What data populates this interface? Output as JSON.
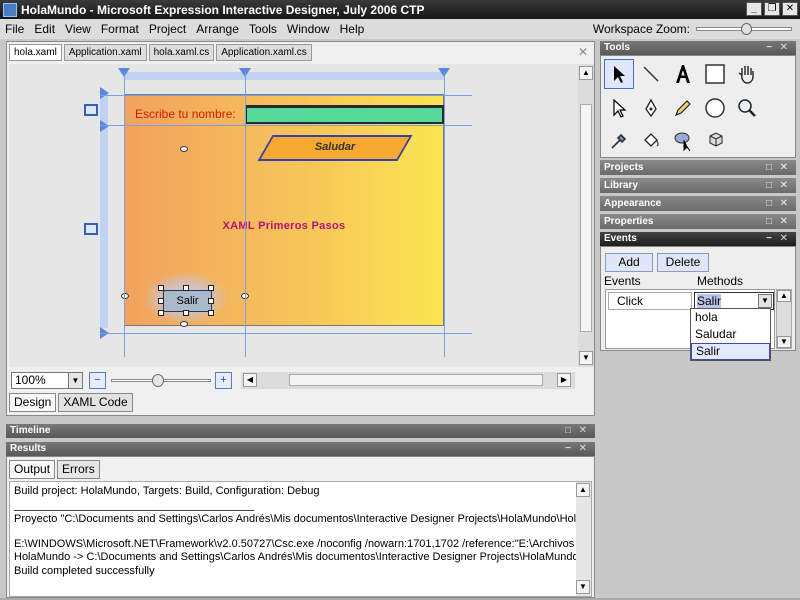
{
  "window": {
    "title": "HolaMundo - Microsoft Expression Interactive Designer, July 2006 CTP",
    "minimize": "_",
    "restore": "❐",
    "close": "✕"
  },
  "menu": [
    "File",
    "Edit",
    "View",
    "Format",
    "Project",
    "Arrange",
    "Tools",
    "Window",
    "Help"
  ],
  "workspace_zoom_label": "Workspace Zoom:",
  "document_tabs": [
    "hola.xaml",
    "Application.xaml",
    "hola.xaml.cs",
    "Application.xaml.cs"
  ],
  "artboard": {
    "name_label": "Escribe tu nombre:",
    "saludar_label": "Saludar",
    "heading": "XAML Primeros Pasos",
    "salir_label": "Salir"
  },
  "zoom_value": "100%",
  "view_tabs": [
    "Design",
    "XAML Code"
  ],
  "panels": {
    "timeline": "Timeline",
    "results": "Results",
    "tools": "Tools",
    "projects": "Projects",
    "library": "Library",
    "appearance": "Appearance",
    "properties": "Properties",
    "events": "Events"
  },
  "result_tabs": [
    "Output",
    "Errors"
  ],
  "output_lines": [
    "Build project: HolaMundo, Targets: Build, Configuration: Debug",
    "Proyecto \"C:\\Documents and Settings\\Carlos Andrés\\Mis documentos\\Interactive Designer Projects\\HolaMundo\\Hola",
    "E:\\WINDOWS\\Microsoft.NET\\Framework\\v2.0.50727\\Csc.exe /noconfig /nowarn:1701,1702 /reference:\"E:\\Archivos",
    "HolaMundo -> C:\\Documents and Settings\\Carlos Andrés\\Mis documentos\\Interactive Designer Projects\\HolaMundo",
    "Build completed successfully"
  ],
  "events_panel": {
    "add_label": "Add",
    "delete_label": "Delete",
    "events_header": "Events",
    "methods_header": "Methods",
    "event_name": "Click",
    "selected_method": "Salir",
    "method_options": [
      "hola",
      "Saludar",
      "Salir"
    ]
  },
  "colors": {
    "artboard_start": "#f2a25e",
    "artboard_end": "#fbe552",
    "textbox": "#56d99b",
    "button_fill": "#f6a830",
    "heading": "#b6117a",
    "label": "#cc1e00"
  }
}
